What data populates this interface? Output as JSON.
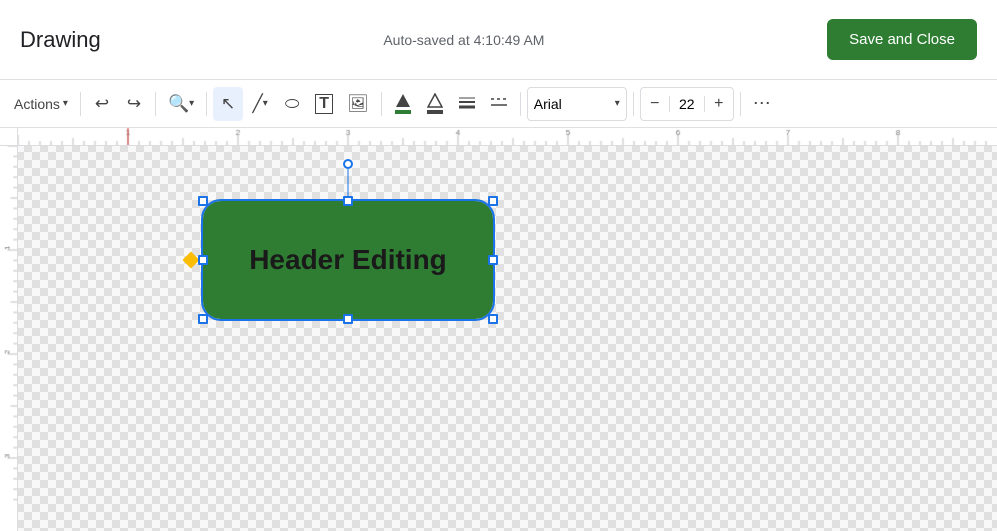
{
  "header": {
    "title": "Drawing",
    "autosave": "Auto-saved at 4:10:49 AM",
    "save_close_label": "Save and Close"
  },
  "toolbar": {
    "actions_label": "Actions",
    "font_name": "Arial",
    "font_size": "22",
    "undo_icon": "↩",
    "redo_icon": "↪",
    "zoom_icon": "⌕",
    "select_icon": "↖",
    "line_icon": "╱",
    "shape_icon": "○",
    "text_icon": "T",
    "image_icon": "▣",
    "fill_icon": "▲",
    "border_icon": "△",
    "line_weight_icon": "≡",
    "line_dash_icon": "⋮",
    "decrease_icon": "−",
    "increase_icon": "+",
    "more_icon": "⋯"
  },
  "canvas": {
    "shape": {
      "text": "Header Editing",
      "bg_color": "#2e7d32",
      "text_color": "#1a1a1a"
    }
  },
  "colors": {
    "accent_blue": "#1a73e8",
    "btn_green": "#2e7d32",
    "shape_green": "#2e7d32",
    "yellow_handle": "#fbbc04"
  }
}
